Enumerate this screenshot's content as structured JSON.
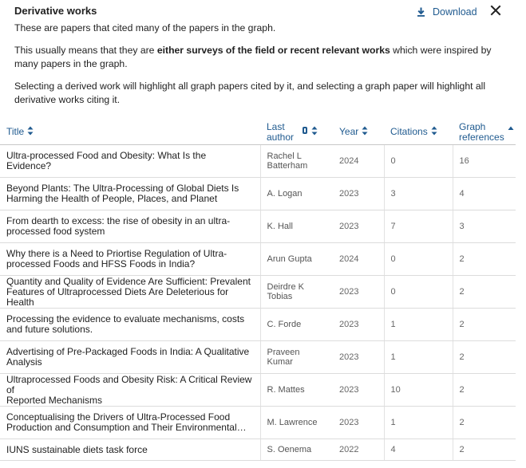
{
  "panel": {
    "title": "Derivative works",
    "download_label": "Download",
    "intro": "These are papers that cited many of the papers in the graph.",
    "explain_pre": "This usually means that they are ",
    "explain_bold": "either surveys of the field or recent relevant works",
    "explain_post": " which were inspired by many papers in the graph.",
    "help": "Selecting a derived work will highlight all graph papers cited by it, and selecting a graph paper will highlight all derivative works citing it."
  },
  "icons": {
    "download": "download-icon",
    "close": "close-icon",
    "sort": "sort-both-icon",
    "sort_active": "sort-desc-icon",
    "pin": "pin-icon"
  },
  "colors": {
    "accent": "#1f5a8f",
    "text": "#212121",
    "muted": "#555555",
    "border": "#dcdcdc"
  },
  "table": {
    "headers": {
      "title": "Title",
      "author_l1": "Last",
      "author_l2": "author",
      "year": "Year",
      "citations": "Citations",
      "refs_l1": "Graph",
      "refs_l2": "references"
    },
    "rows": [
      {
        "t1": "Ultra-processed Food and Obesity: What Is the Evidence?",
        "t2": "",
        "a1": "Rachel L",
        "a2": "Batterham",
        "year": "2024",
        "citations": "0",
        "refs": "16"
      },
      {
        "t1": "Beyond Plants: The Ultra-Processing of Global Diets Is",
        "t2": "Harming the Health of People, Places, and Planet",
        "a1": "A. Logan",
        "a2": "",
        "year": "2023",
        "citations": "3",
        "refs": "4"
      },
      {
        "t1": "From dearth to excess: the rise of obesity in an ultra-",
        "t2": "processed food system",
        "a1": "K. Hall",
        "a2": "",
        "year": "2023",
        "citations": "7",
        "refs": "3"
      },
      {
        "t1": "Why there is a Need to Priortise Regulation of Ultra-",
        "t2": "processed Foods and HFSS Foods in India?",
        "a1": "Arun Gupta",
        "a2": "",
        "year": "2024",
        "citations": "0",
        "refs": "2"
      },
      {
        "t1": "Quantity and Quality of Evidence Are Sufficient: Prevalent",
        "t2": "Features of Ultraprocessed Diets Are Deleterious for Health",
        "a1": "Deirdre K",
        "a2": "Tobias",
        "year": "2023",
        "citations": "0",
        "refs": "2"
      },
      {
        "t1": "Processing the evidence to evaluate mechanisms, costs",
        "t2": "and future solutions.",
        "a1": "C. Forde",
        "a2": "",
        "year": "2023",
        "citations": "1",
        "refs": "2"
      },
      {
        "t1": "Advertising of Pre-Packaged Foods in India: A Qualitative",
        "t2": "Analysis",
        "a1": "Praveen",
        "a2": "Kumar",
        "year": "2023",
        "citations": "1",
        "refs": "2"
      },
      {
        "t1": "Ultraprocessed Foods and Obesity Risk: A Critical Review of",
        "t2": "Reported Mechanisms",
        "a1": "R. Mattes",
        "a2": "",
        "year": "2023",
        "citations": "10",
        "refs": "2"
      },
      {
        "t1": "Conceptualising the Drivers of Ultra-Processed Food",
        "t2": "Production and Consumption and Their Environmental…",
        "a1": "M. Lawrence",
        "a2": "",
        "year": "2023",
        "citations": "1",
        "refs": "2"
      },
      {
        "t1": "IUNS sustainable diets task force",
        "t2": "",
        "a1": "S. Oenema",
        "a2": "",
        "year": "2022",
        "citations": "4",
        "refs": "2"
      }
    ]
  }
}
